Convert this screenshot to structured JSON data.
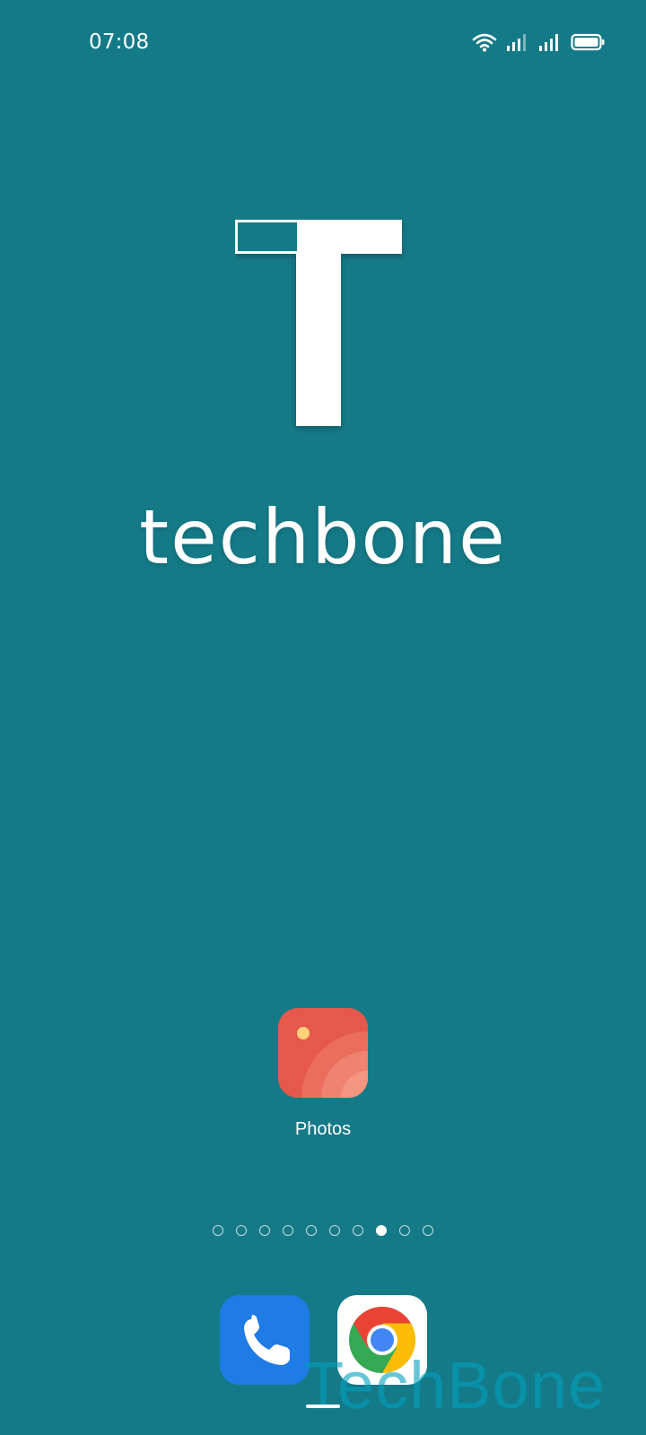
{
  "status_bar": {
    "time": "07:08",
    "icons": [
      "wifi-icon",
      "signal-icon",
      "signal-icon",
      "battery-icon"
    ]
  },
  "wallpaper": {
    "brand_word": "techbone",
    "logo_letter": "T",
    "background_color": "#157a87"
  },
  "home_screen": {
    "apps": [
      {
        "label": "Photos",
        "icon": "photos-icon",
        "color": "#e5584b"
      }
    ],
    "page_count": 10,
    "active_page": 8
  },
  "dock": {
    "apps": [
      {
        "icon": "phone-icon",
        "color": "#1f7be6"
      },
      {
        "icon": "chrome-icon",
        "color": "#ffffff"
      }
    ]
  },
  "watermark": "TechBone"
}
